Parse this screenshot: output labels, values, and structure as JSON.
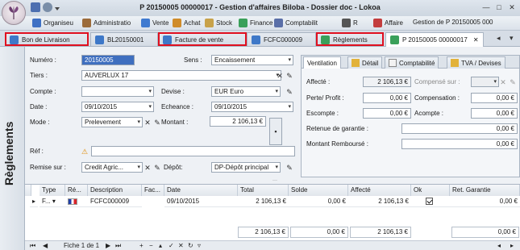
{
  "window": {
    "title": "P 20150005 00000017 - Gestion d'affaires Biloba - Dossier doc - Lokoa"
  },
  "menu": {
    "items": [
      "Organiseu",
      "Administratio",
      "Vente",
      "Achat",
      "Stock",
      "Finance",
      "Comptabilit",
      "R",
      "Affaire",
      "Gestion de P 20150005 000"
    ]
  },
  "tabs": {
    "items": [
      "Bon de Livraison",
      "BL20150001",
      "Facture de vente",
      "FCFC000009",
      "Règlements",
      "P 20150005 00000017"
    ]
  },
  "side": {
    "label": "Règlements"
  },
  "form": {
    "numero_label": "Numéro :",
    "numero_value": "20150005",
    "sens_label": "Sens :",
    "sens_value": "Encaissement",
    "tiers_label": "Tiers :",
    "tiers_value": "AUVERLUX 17",
    "compte_label": "Compte :",
    "devise_label": "Devise :",
    "devise_value": "EUR Euro",
    "date_label": "Date :",
    "date_value": "09/10/2015",
    "echeance_label": "Echeance :",
    "echeance_value": "09/10/2015",
    "mode_label": "Mode :",
    "mode_value": "Prelevement",
    "montant_label": "Montant :",
    "montant_value": "2 106,13 €",
    "ref_label": "Réf :",
    "remise_label": "Remise sur :",
    "remise_value": "Credit Agric...",
    "depot_label": "Dépôt:",
    "depot_value": "DP-Dépôt principal"
  },
  "ventilation": {
    "tabs": [
      "Ventilation",
      "Détail",
      "Comptabilité",
      "TVA / Devises"
    ],
    "affecte_label": "Affecté :",
    "affecte_value": "2 106,13 €",
    "compense_label": "Compensé sur :",
    "perte_label": "Perte/ Profit :",
    "perte_value": "0,00 €",
    "compensation_label": "Compensation :",
    "compensation_value": "0,00 €",
    "escompte_label": "Escompte :",
    "escompte_value": "0,00 €",
    "acompte_label": "Acompte :",
    "acompte_value": "0,00 €",
    "retenue_label": "Retenue de garantie :",
    "retenue_value": "0,00 €",
    "montant_rembourse_label": "Montant Remboursé :",
    "montant_rembourse_value": "0,00 €"
  },
  "grid": {
    "headers": [
      "Type",
      "Ré...",
      "Description",
      "Fac...",
      "Date",
      "Total",
      "Solde",
      "Affecté",
      "Ok",
      "Ret. Garantie"
    ],
    "row": {
      "type": "F...",
      "description": "FCFC000009",
      "date": "09/10/2015",
      "total": "2 106,13 €",
      "solde": "0,00 €",
      "affecte": "2 106,13 €",
      "ret": "0,00 €"
    },
    "totals": {
      "total": "2 106,13 €",
      "solde": "0,00 €",
      "affecte": "2 106,13 €",
      "ret": "0,00 €"
    },
    "pager": "Fiche 1 de 1"
  }
}
